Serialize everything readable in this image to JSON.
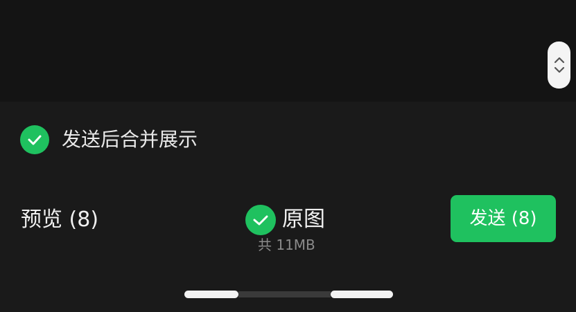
{
  "merge_option": {
    "label": "发送后合并展示",
    "checked": true
  },
  "preview": {
    "label": "预览 (8)"
  },
  "original_option": {
    "label": "原图",
    "checked": true,
    "size_text": "共 11MB"
  },
  "send_button": {
    "label": "发送 (8)"
  },
  "icons": {
    "scroll_handle": "chevron-up-down-icon",
    "check": "checkmark-icon"
  },
  "colors": {
    "accent": "#1fc15f",
    "background": "#181818",
    "text_primary": "#f0f0f0",
    "text_secondary": "#8a8a8a"
  }
}
